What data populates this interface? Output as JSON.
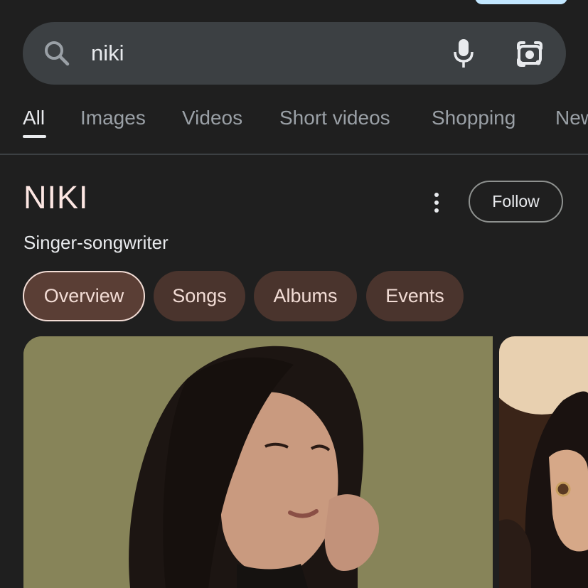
{
  "search": {
    "query": "niki"
  },
  "tabs": [
    {
      "label": "All",
      "active": true
    },
    {
      "label": "Images"
    },
    {
      "label": "Videos"
    },
    {
      "label": "Short videos"
    },
    {
      "label": "Shopping"
    },
    {
      "label": "New"
    }
  ],
  "entity": {
    "title": "NIKI",
    "subtitle": "Singer-songwriter",
    "follow_label": "Follow"
  },
  "chips": [
    {
      "label": "Overview",
      "active": true
    },
    {
      "label": "Songs"
    },
    {
      "label": "Albums"
    },
    {
      "label": "Events"
    }
  ],
  "icons": {
    "search": "search-icon",
    "mic": "mic-icon",
    "lens": "camera-lens-icon",
    "more": "more-vert-icon"
  },
  "colors": {
    "background": "#1f1f1f",
    "search_bar": "#3c4043",
    "chip": "#4a342d",
    "chip_active": "#5a3e35",
    "title": "#fde7e3"
  }
}
